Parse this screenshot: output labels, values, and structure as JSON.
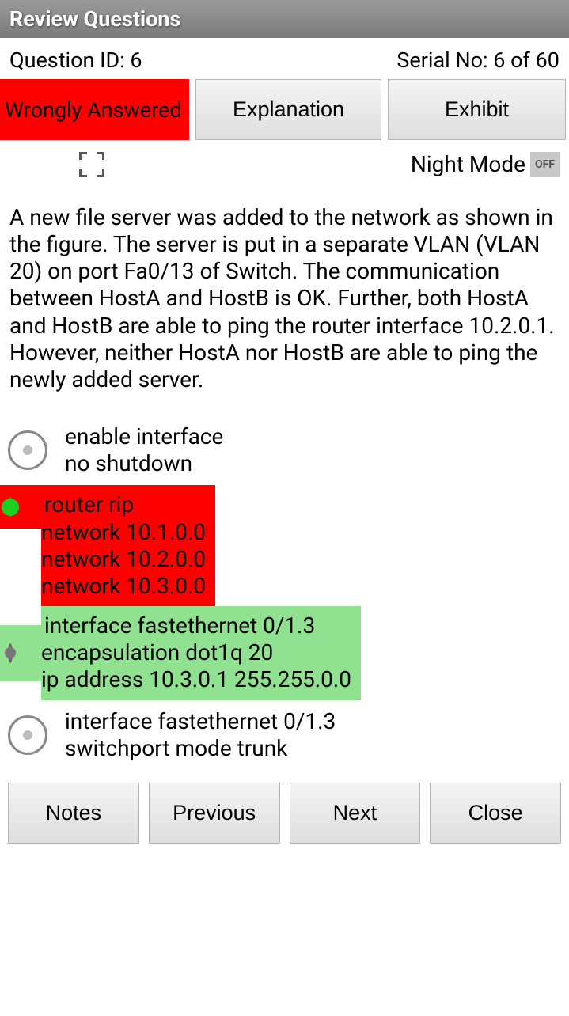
{
  "title": "Review Questions",
  "info": {
    "question_id_label": "Question ID: 6",
    "serial_label": "Serial No: 6 of 60"
  },
  "status": {
    "badge": "Wrongly Answered",
    "explanation_btn": "Explanation",
    "exhibit_btn": "Exhibit"
  },
  "mode": {
    "night_label": "Night Mode",
    "toggle_value": "OFF"
  },
  "question": "A new file server was added to the network as shown in the figure. The server is put in a separate VLAN (VLAN 20) on port Fa0/13 of Switch. The communication between HostA and HostB is OK. Further, both HostA and HostB are able to ping the router interface 10.2.0.1. However, neither HostA nor HostB are able to ping the newly added server.",
  "options": [
    {
      "text": "enable interface\n no shutdown",
      "state": "plain"
    },
    {
      "text": "router rip\nnetwork 10.1.0.0\nnetwork 10.2.0.0\nnetwork 10.3.0.0",
      "state": "wrong"
    },
    {
      "text": "interface fastethernet 0/1.3\nencapsulation dot1q 20\nip address 10.3.0.1 255.255.0.0",
      "state": "correct"
    },
    {
      "text": "interface fastethernet 0/1.3\nswitchport mode trunk",
      "state": "plain"
    }
  ],
  "nav": {
    "notes": "Notes",
    "previous": "Previous",
    "next": "Next",
    "close": "Close"
  }
}
